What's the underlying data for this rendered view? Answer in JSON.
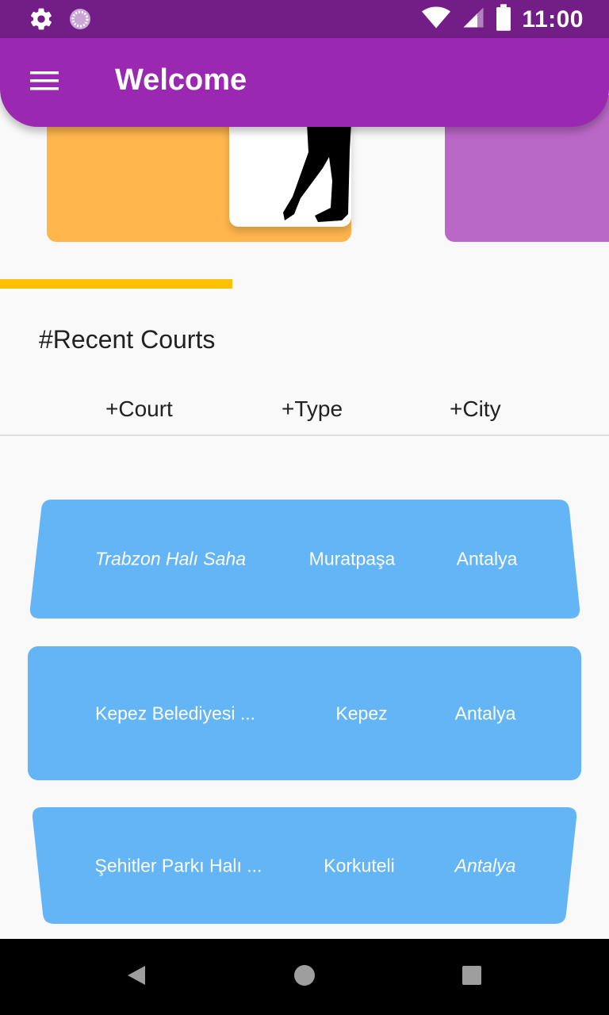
{
  "status_bar": {
    "time": "11:00",
    "icons": [
      "gear-icon",
      "loading-icon",
      "wifi-icon",
      "signal-icon",
      "battery-icon"
    ]
  },
  "app_bar": {
    "title": "Welcome",
    "menu_icon": "menu-icon",
    "color": "#9a28b1"
  },
  "carousel": {
    "colors": [
      "#ffb74d",
      "#ba68c8"
    ],
    "indicator_color": "#ffc107"
  },
  "section": {
    "title": "#Recent Courts"
  },
  "columns": {
    "court": "+Court",
    "type": "+Type",
    "city": "+City"
  },
  "courts": [
    {
      "name": "Trabzon Halı Saha",
      "district": "Muratpaşa",
      "city": "Antalya"
    },
    {
      "name": "Kepez Belediyesi ...",
      "district": "Kepez",
      "city": "Antalya"
    },
    {
      "name": "Şehitler Parkı Halı ...",
      "district": "Korkuteli",
      "city": "Antalya"
    }
  ],
  "row_color": "#64b5f6",
  "nav": {
    "icons": [
      "back-icon",
      "home-icon",
      "recents-icon"
    ]
  }
}
